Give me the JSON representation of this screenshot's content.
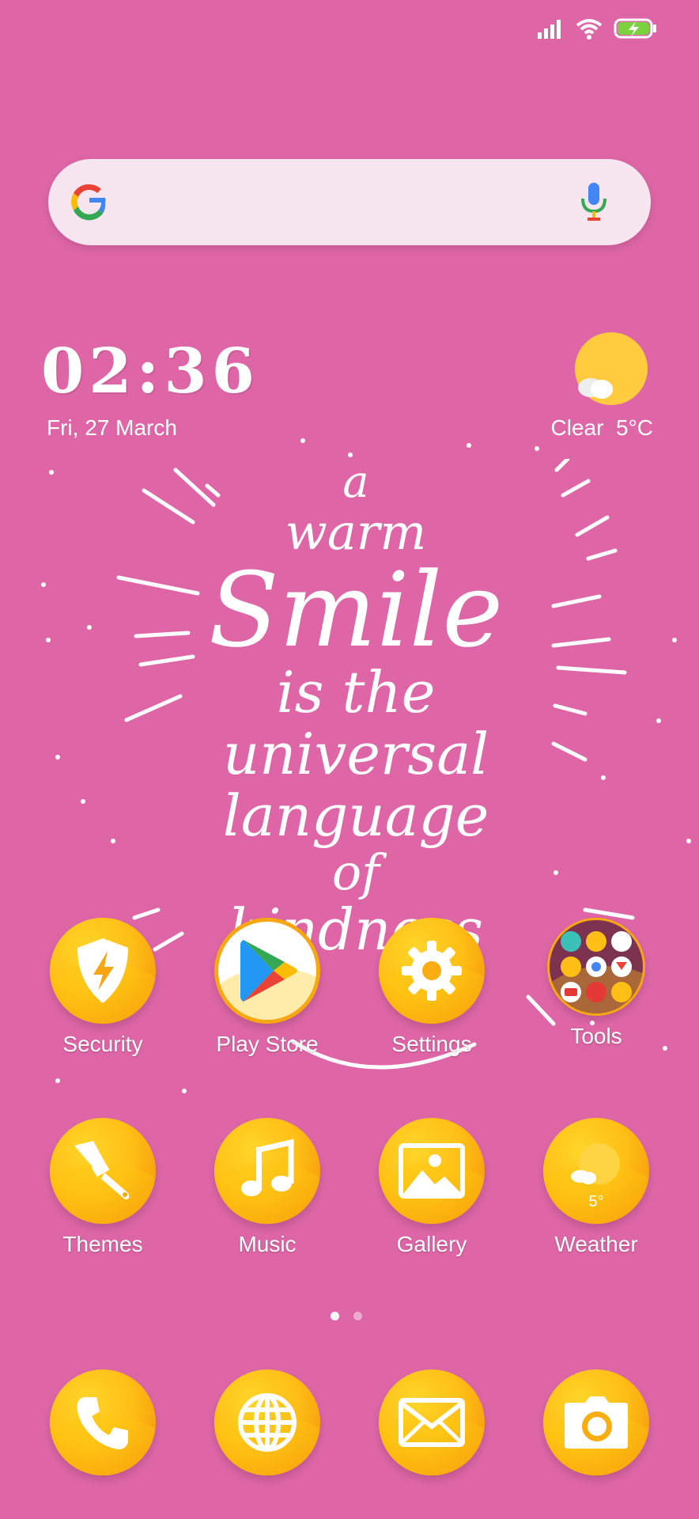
{
  "status_bar": {
    "icons": [
      "signal-icon",
      "wifi-icon",
      "battery-charging-icon"
    ]
  },
  "search": {
    "logo": "google-logo",
    "mic": "microphone-icon"
  },
  "clock": {
    "time": "02:36",
    "date": "Fri, 27 March"
  },
  "weather_widget": {
    "icon": "sun-cloud-icon",
    "condition": "Clear",
    "temp": "5°C"
  },
  "wallpaper_quote": {
    "line1": "a",
    "line2": "warm",
    "line3": "Smile",
    "line4": "is the",
    "line5": "universal",
    "line6": "language",
    "line7": "of",
    "line8": "kindness"
  },
  "apps_row1": [
    {
      "label": "Security",
      "icon": "shield-bolt-icon"
    },
    {
      "label": "Play Store",
      "icon": "play-store-icon"
    },
    {
      "label": "Settings",
      "icon": "gear-icon"
    },
    {
      "label": "Tools",
      "icon": "folder-icon"
    }
  ],
  "apps_row2": [
    {
      "label": "Themes",
      "icon": "paintbrush-icon"
    },
    {
      "label": "Music",
      "icon": "music-note-icon"
    },
    {
      "label": "Gallery",
      "icon": "image-icon"
    },
    {
      "label": "Weather",
      "icon": "weather-icon",
      "badge": "5°"
    }
  ],
  "pager": {
    "pages": 2,
    "active": 1
  },
  "dock": [
    {
      "icon": "phone-icon"
    },
    {
      "icon": "globe-icon"
    },
    {
      "icon": "mail-icon"
    },
    {
      "icon": "camera-icon"
    }
  ],
  "colors": {
    "background": "#de66a7",
    "accent": "#ffb91a"
  }
}
